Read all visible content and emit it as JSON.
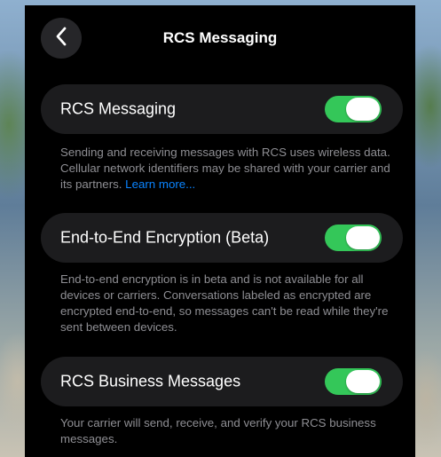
{
  "nav": {
    "title": "RCS Messaging",
    "back_icon": "chevron-left-icon"
  },
  "settings": [
    {
      "label": "RCS Messaging",
      "enabled": true,
      "footnote": "Sending and receiving messages with RCS uses wireless data. Cellular network identifiers may be shared with your carrier and its partners.",
      "link": "Learn more..."
    },
    {
      "label": "End-to-End Encryption (Beta)",
      "enabled": true,
      "footnote": "End-to-end encryption is in beta and is not available for all devices or carriers. Conversations labeled as encrypted are encrypted end-to-end, so messages can't be read while they're sent between devices."
    },
    {
      "label": "RCS Business Messages",
      "enabled": true,
      "footnote": "Your carrier will send, receive, and verify your RCS business messages."
    }
  ],
  "colors": {
    "toggle_on": "#34c759",
    "link": "#0a84ff",
    "footnote_text": "#8e8e93",
    "row_background": "#1c1c1e"
  }
}
